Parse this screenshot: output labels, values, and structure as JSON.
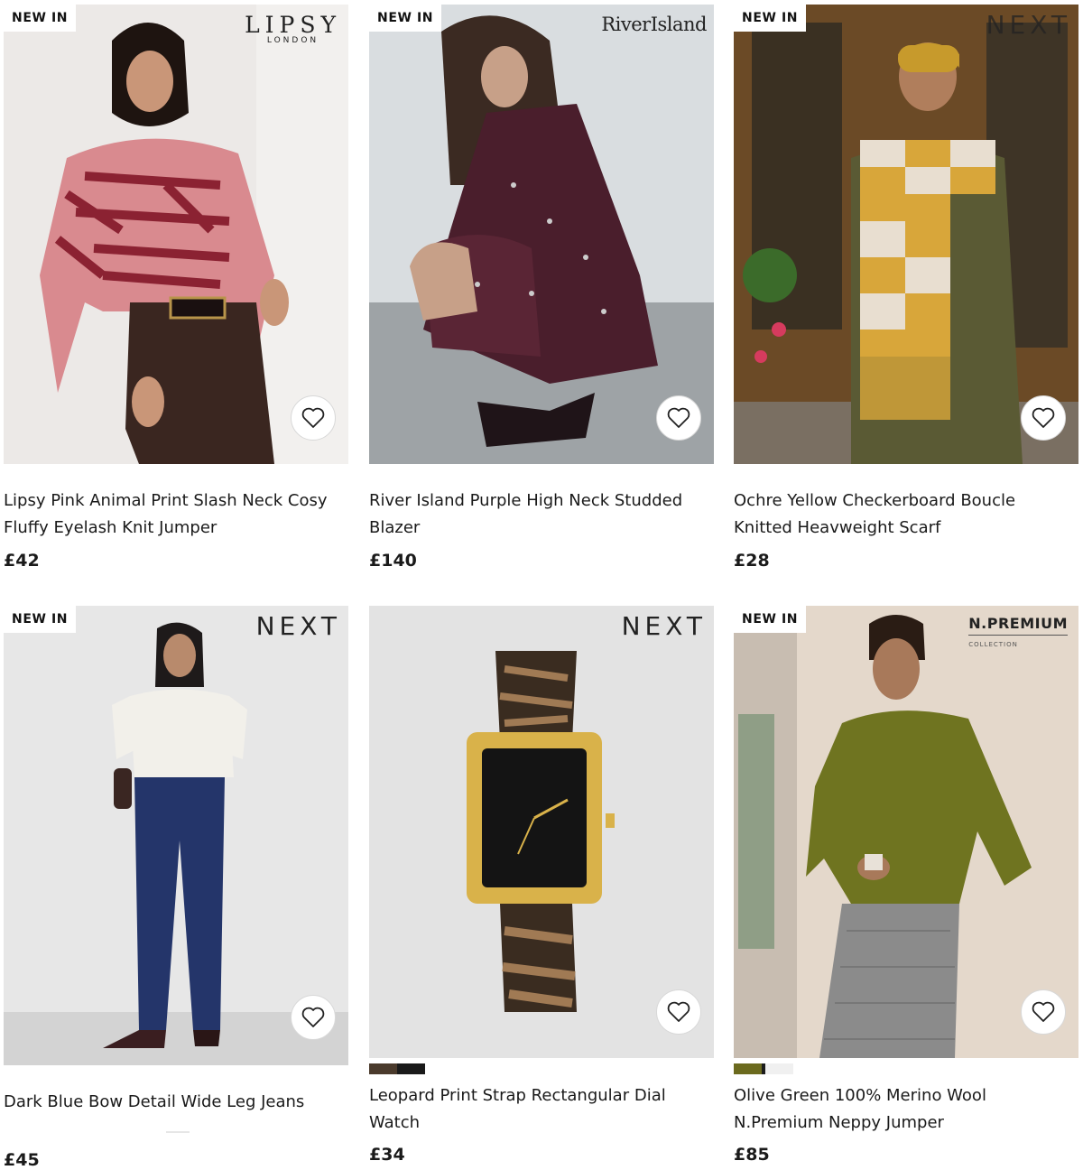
{
  "products": [
    {
      "badge": "NEW IN",
      "brand_line1": "LIPSY",
      "brand_line2": "LONDON",
      "title": "Lipsy Pink Animal Print Slash Neck Cosy Fluffy Eyelash Knit Jumper",
      "price": "£42",
      "favourite_icon": "heart-outline-icon"
    },
    {
      "badge": "NEW IN",
      "brand_line1": "RiverIsland",
      "title": "River Island Purple High Neck Studded Blazer",
      "price": "£140",
      "favourite_icon": "heart-outline-icon"
    },
    {
      "badge": "NEW IN",
      "brand_line1": "NEXT",
      "title": "Ochre Yellow Checkerboard Boucle Knitted Heavweight Scarf",
      "price": "£28",
      "favourite_icon": "heart-outline-icon"
    },
    {
      "badge": "NEW IN",
      "brand_line1": "NEXT",
      "title": "Dark Blue Bow Detail Wide Leg Jeans",
      "price": "£45",
      "favourite_icon": "heart-outline-icon"
    },
    {
      "brand_line1": "NEXT",
      "title": "Leopard Print Strap Rectangular Dial Watch",
      "price": "£34",
      "swatch_colors": [
        "#4a3a2c",
        "#1a1a1a"
      ],
      "favourite_icon": "heart-outline-icon"
    },
    {
      "badge": "NEW IN",
      "brand_line1": "N.PREMIUM",
      "brand_line2": "COLLECTION",
      "title": "Olive Green 100% Merino Wool N.Premium Neppy Jumper",
      "price": "£85",
      "swatch_colors": [
        "#6b6a1e",
        "#1c1c1c",
        "#f0f0f0"
      ],
      "favourite_icon": "heart-outline-icon"
    }
  ]
}
